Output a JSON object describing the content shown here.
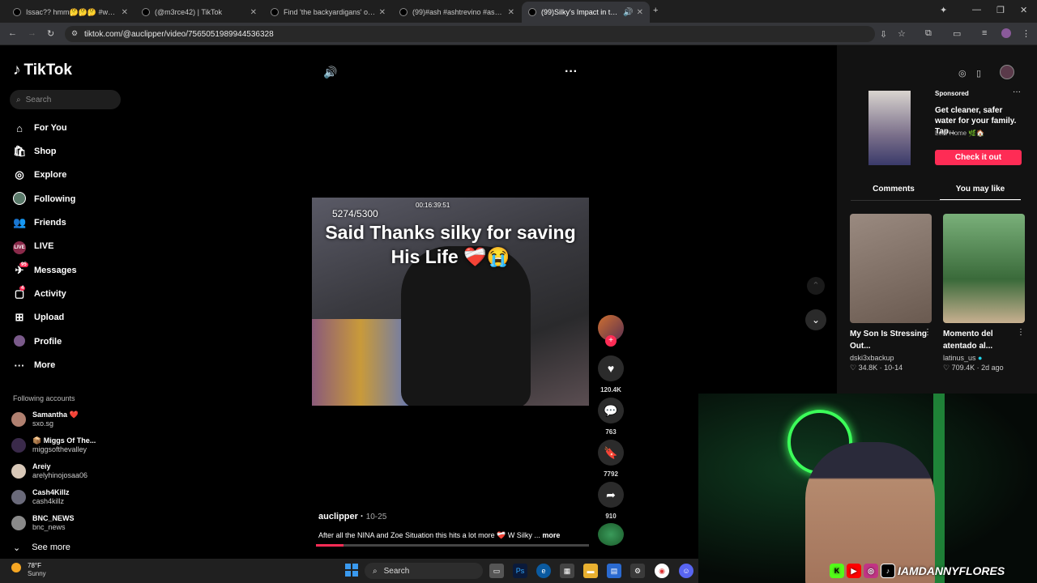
{
  "browser": {
    "tabs": [
      {
        "label": "Issac?? hmm🤔🤔🤔 #wendyo"
      },
      {
        "label": "(@m3rce42) | TikTok"
      },
      {
        "label": "Find 'the backyardigans' on Tik"
      },
      {
        "label": "(99)#ash #ashtrevino #ashleytr"
      },
      {
        "label": "(99)Silky's Impact in the Ni"
      }
    ],
    "url": "tiktok.com/@auclipper/video/7565051989944536328"
  },
  "sidebar": {
    "logo": "TikTok",
    "search_placeholder": "Search",
    "nav": [
      {
        "label": "For You",
        "icon": "home-icon"
      },
      {
        "label": "Shop",
        "icon": "shop-icon"
      },
      {
        "label": "Explore",
        "icon": "compass-icon"
      },
      {
        "label": "Following",
        "icon": "following-avatar"
      },
      {
        "label": "Friends",
        "icon": "friends-icon"
      },
      {
        "label": "LIVE",
        "icon": "live-icon"
      },
      {
        "label": "Messages",
        "icon": "messages-icon",
        "badge": "95"
      },
      {
        "label": "Activity",
        "icon": "activity-icon",
        "badge": "4"
      },
      {
        "label": "Upload",
        "icon": "upload-icon"
      },
      {
        "label": "Profile",
        "icon": "profile-avatar"
      },
      {
        "label": "More",
        "icon": "more-icon"
      }
    ],
    "following_header": "Following accounts",
    "following": [
      {
        "name": "Samantha ❤️",
        "handle": "sxo.sg"
      },
      {
        "name": "📦 Miggs Of The...",
        "handle": "miggsofthevalley"
      },
      {
        "name": "Areiy",
        "handle": "arelyhinojosaa06"
      },
      {
        "name": "Cash4Killz",
        "handle": "cash4killz"
      },
      {
        "name": "BNC_NEWS",
        "handle": "bnc_news"
      }
    ],
    "see_more": "See more"
  },
  "video": {
    "caption": "Said Thanks silky for saving His Life ❤️‍🩹😭",
    "counter": "5274/5300",
    "timer": "00:16:39:51",
    "author": "auclipper",
    "date": "10-25",
    "description": "After all the NINA and Zoe Situation this hits a lot more ❤️‍🩹 W Silky ...",
    "more": "more",
    "progress": 0.1,
    "likes": "120.4K",
    "comments": "763",
    "saves": "7792",
    "shares": "910"
  },
  "right_panel": {
    "sponsored": "Sponsored",
    "ad_title": "Get cleaner, safer water for your family. Tap...",
    "ad_brand": "Leaf Home 🌿🏠",
    "ad_cta": "Check it out",
    "tabs": [
      "Comments",
      "You may like"
    ],
    "cards": [
      {
        "title": "My Son Is Stressing Out...",
        "author": "dski3xbackup",
        "likes": "34.8K",
        "date": "10-14"
      },
      {
        "title": "Momento del atentado al...",
        "author": "latinus_us",
        "likes": "709.4K",
        "date": "2d ago"
      }
    ]
  },
  "webcam": {
    "tag": "IAMDANNYFLORES"
  },
  "taskbar": {
    "weather_temp": "78°F",
    "weather_desc": "Sunny",
    "search": "Search"
  },
  "colors": {
    "accent": "#fe2c55",
    "bg": "#000000"
  }
}
